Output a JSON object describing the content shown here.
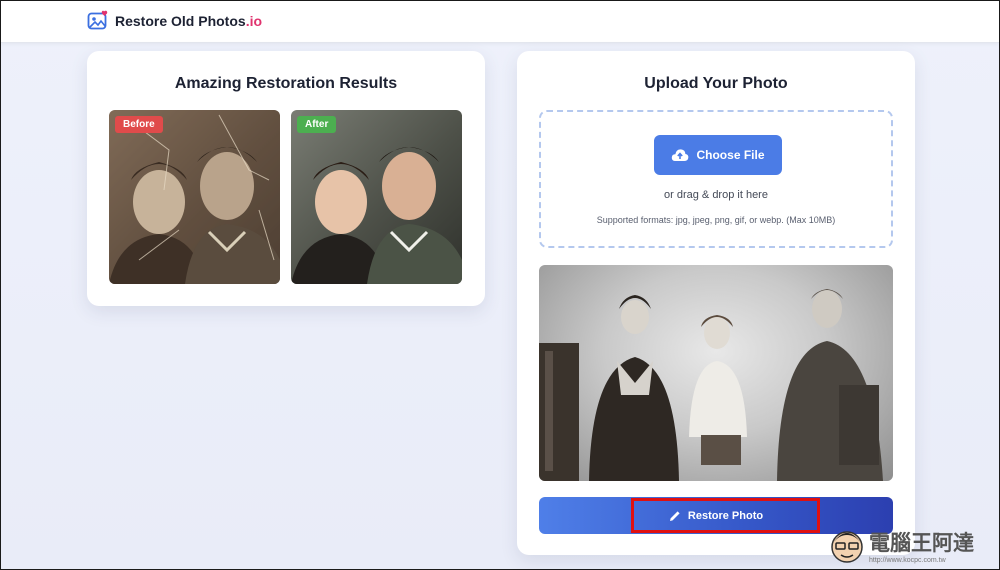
{
  "brand": {
    "name": "Restore Old Photos",
    "suffix": ".io",
    "suffix_color": "#e0336e",
    "icon": "photo-heart-icon"
  },
  "results": {
    "title": "Amazing Restoration Results",
    "before_label": "Before",
    "after_label": "After"
  },
  "upload": {
    "title": "Upload Your Photo",
    "choose_label": "Choose File",
    "drag_text": "or drag & drop it here",
    "formats_text": "Supported formats: jpg, jpeg, png, gif, or webp. (Max 10MB)"
  },
  "restore": {
    "label": "Restore Photo",
    "icon": "pencil-icon"
  },
  "watermark": {
    "text": "電腦王阿達",
    "url": "http://www.kocpc.com.tw"
  },
  "colors": {
    "accent": "#4b7ce6",
    "badge_before": "#e04b4b",
    "badge_after": "#4caf50",
    "highlight": "#e01010"
  }
}
